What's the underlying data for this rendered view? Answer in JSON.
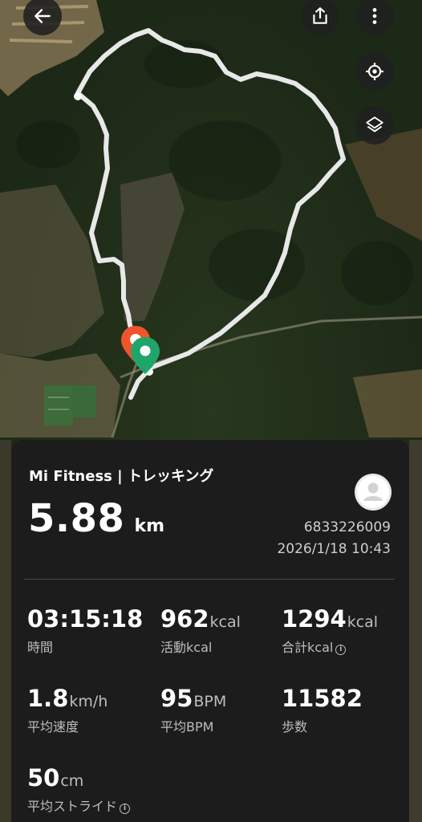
{
  "colors": {
    "route": "#e8e8e8",
    "start_marker": "#f0542c",
    "end_marker": "#1fa56a",
    "sheet_bg": "#1c1c1c"
  },
  "toolbar": {
    "back_icon": "back-arrow-icon",
    "share_icon": "share-icon",
    "more_icon": "more-vert-icon",
    "locate_icon": "locate-icon",
    "layers_icon": "layers-icon"
  },
  "summary": {
    "app_title": "Mi Fitness | トレッキング",
    "distance_value": "5.88",
    "distance_unit": "km",
    "user_id": "6833226009",
    "datetime": "2026/1/18 10:43"
  },
  "stats": [
    {
      "value": "03:15:18",
      "unit": "",
      "label": "時間",
      "info": false
    },
    {
      "value": "962",
      "unit": "kcal",
      "label": "活動kcal",
      "info": false
    },
    {
      "value": "1294",
      "unit": "kcal",
      "label": "合計kcal",
      "info": true
    },
    {
      "value": "1.8",
      "unit": "km/h",
      "label": "平均速度",
      "info": false
    },
    {
      "value": "95",
      "unit": "BPM",
      "label": "平均BPM",
      "info": false
    },
    {
      "value": "11582",
      "unit": "",
      "label": "歩数",
      "info": false
    },
    {
      "value": "50",
      "unit": "cm",
      "label": "平均ストライド",
      "info": true
    }
  ]
}
